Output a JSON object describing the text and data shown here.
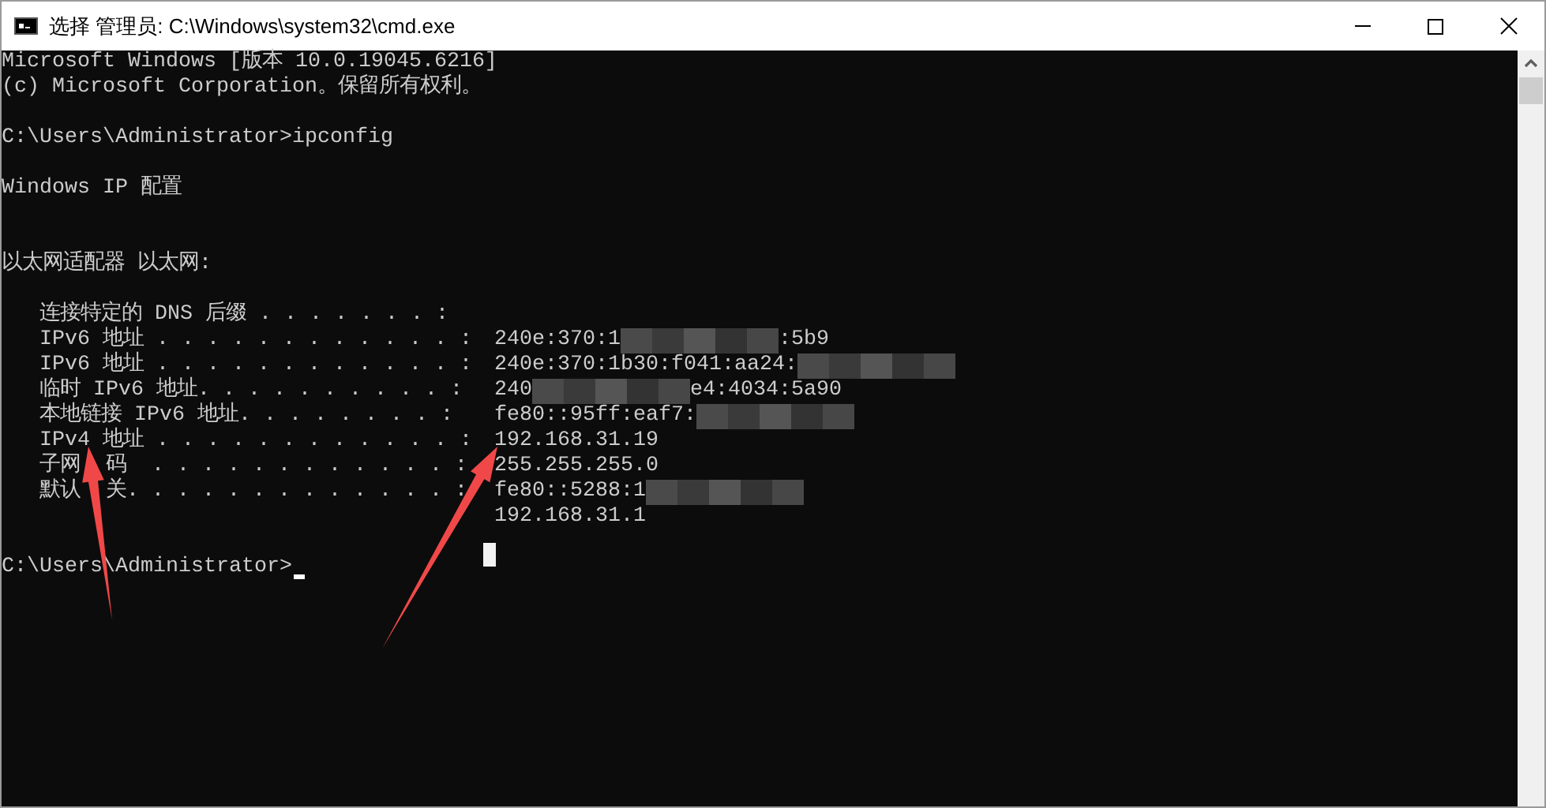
{
  "window": {
    "title": "选择 管理员: C:\\Windows\\system32\\cmd.exe"
  },
  "console": {
    "lines": [
      {
        "kind": "text",
        "text": "Microsoft Windows [版本 10.0.19045.6216]"
      },
      {
        "kind": "text",
        "text": "(c) Microsoft Corporation。保留所有权利。"
      },
      {
        "kind": "blank"
      },
      {
        "kind": "prompt",
        "text": "C:\\Users\\Administrator>ipconfig"
      },
      {
        "kind": "blank"
      },
      {
        "kind": "text",
        "text": "Windows IP 配置"
      },
      {
        "kind": "blank"
      },
      {
        "kind": "blank"
      },
      {
        "kind": "text",
        "text": "以太网适配器 以太网:"
      },
      {
        "kind": "blank"
      },
      {
        "kind": "field",
        "label": "   连接特定的 DNS 后缀 . . . . . . . :"
      },
      {
        "kind": "field",
        "label": "   IPv6 地址 . . . . . . . . . . . . :",
        "value": [
          {
            "kind": "text",
            "text": "240e:370:1"
          },
          {
            "kind": "redacted"
          },
          {
            "kind": "text",
            "text": ":5b9"
          }
        ]
      },
      {
        "kind": "field",
        "label": "   IPv6 地址 . . . . . . . . . . . . :",
        "value": [
          {
            "kind": "text",
            "text": "240e:370:1b30:f041:aa24:"
          },
          {
            "kind": "redacted"
          }
        ]
      },
      {
        "kind": "field",
        "label": "   临时 IPv6 地址. . . . . . . . . . :",
        "value": [
          {
            "kind": "text",
            "text": "240"
          },
          {
            "kind": "redacted"
          },
          {
            "kind": "text",
            "text": "e4:4034:5a90"
          }
        ]
      },
      {
        "kind": "field",
        "label": "   本地链接 IPv6 地址. . . . . . . . :",
        "value": [
          {
            "kind": "text",
            "text": "fe80::95ff:eaf7:"
          },
          {
            "kind": "redacted"
          }
        ]
      },
      {
        "kind": "field",
        "label": "   IPv4 地址 . . . . . . . . . . . . :",
        "value": [
          {
            "kind": "text",
            "text": "192.168.31.19"
          }
        ]
      },
      {
        "kind": "field",
        "label": "   子网",
        "label_after_arrow": "码  . . . . . . . . . . . . :",
        "value": [
          {
            "kind": "text",
            "text": "255.255.255.0"
          }
        ]
      },
      {
        "kind": "field",
        "label": "   默认",
        "label_after_arrow": "关. . . . . . . . . . . . . :",
        "value": [
          {
            "kind": "text",
            "text": "fe80::5288:1"
          },
          {
            "kind": "redacted"
          }
        ]
      },
      {
        "kind": "field",
        "value": [
          {
            "kind": "text",
            "text": "192.168.31.1"
          }
        ]
      },
      {
        "kind": "blank"
      },
      {
        "kind": "prompt",
        "text": "C:\\Users\\Administrator>",
        "cursor": true
      }
    ]
  }
}
